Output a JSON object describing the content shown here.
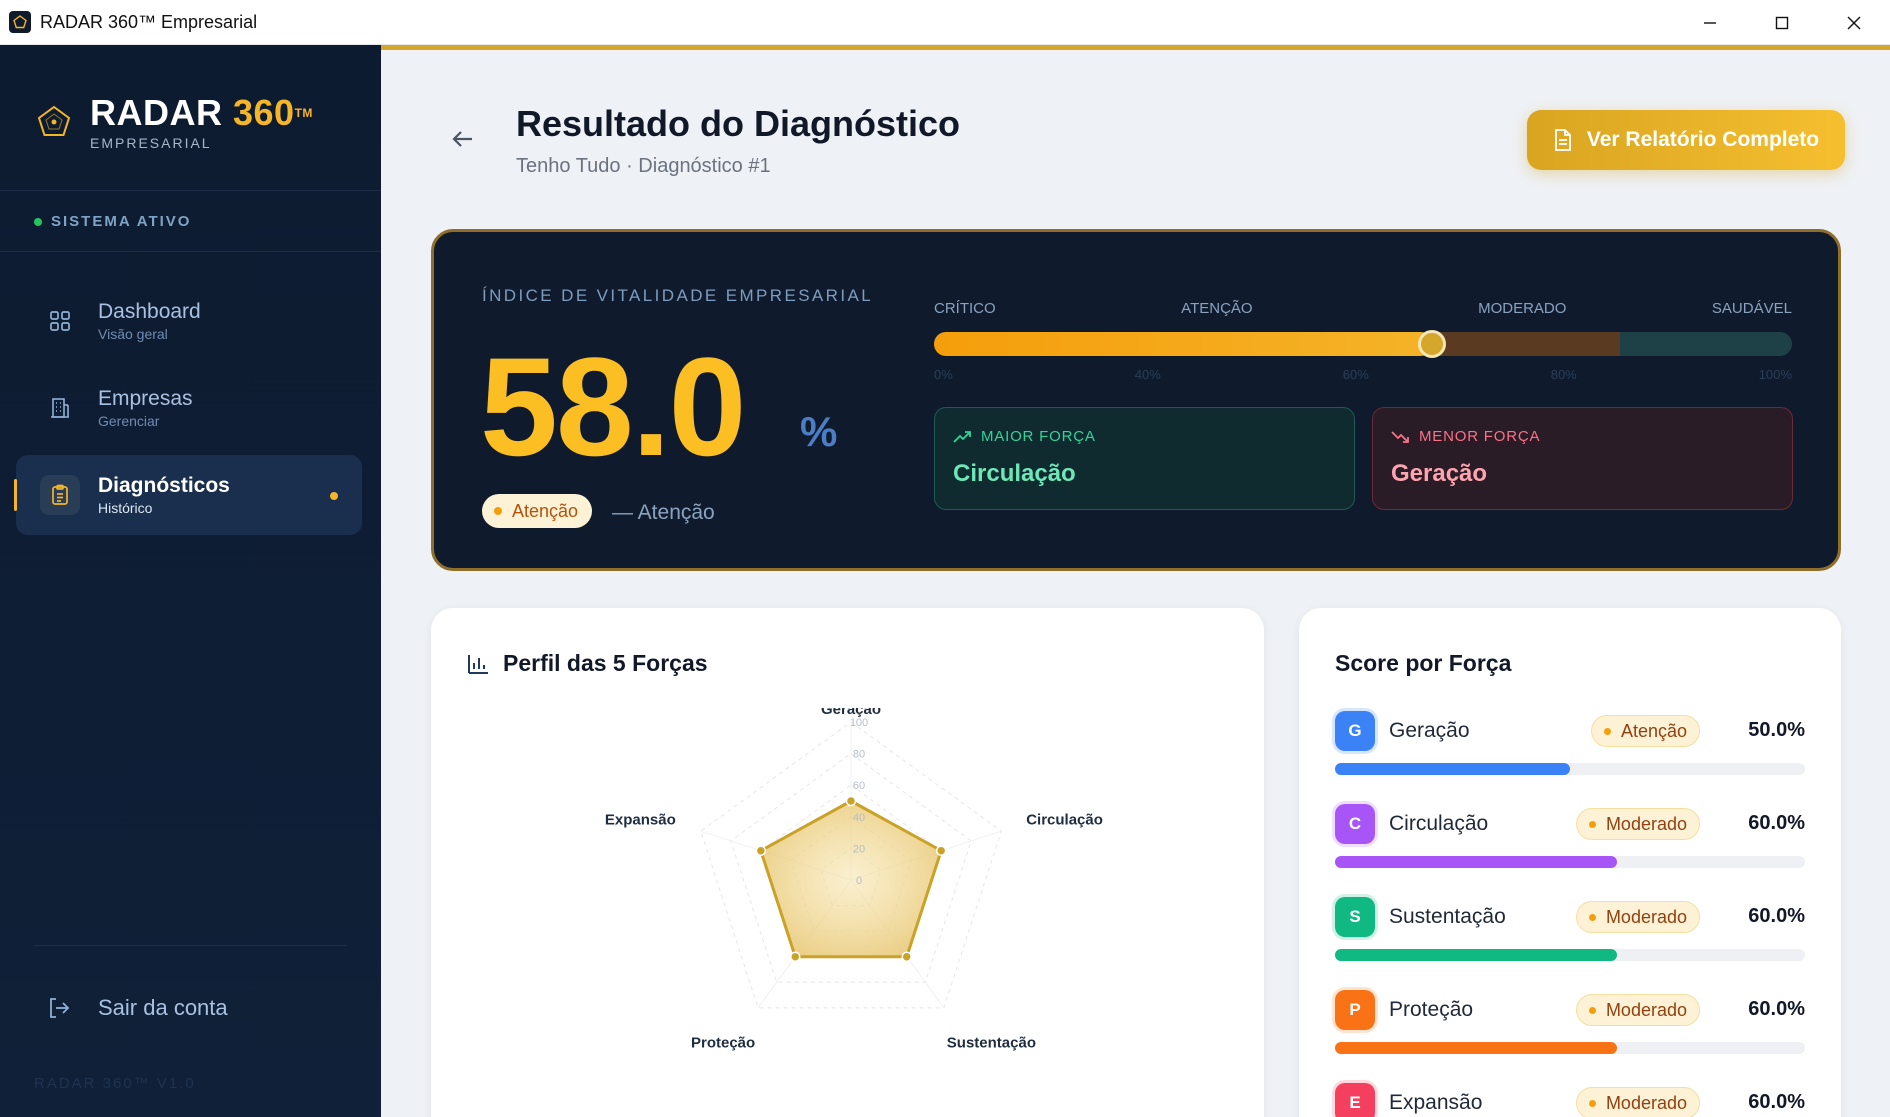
{
  "window": {
    "title": "RADAR 360™ Empresarial"
  },
  "sidebar": {
    "brand_main": "RADAR",
    "brand_num": "360",
    "brand_tm": "TM",
    "brand_sub": "EMPRESARIAL",
    "status": "SISTEMA ATIVO",
    "items": [
      {
        "label": "Dashboard",
        "sub": "Visão geral",
        "icon": "grid-icon"
      },
      {
        "label": "Empresas",
        "sub": "Gerenciar",
        "icon": "building-icon"
      },
      {
        "label": "Diagnósticos",
        "sub": "Histórico",
        "icon": "clipboard-icon"
      }
    ],
    "logout": "Sair da conta",
    "version": "RADAR 360™ V1.0"
  },
  "header": {
    "title": "Resultado do Diagnóstico",
    "subtitle": "Tenho Tudo · Diagnóstico #1",
    "report_button": "Ver Relatório Completo"
  },
  "hero": {
    "kicker": "ÍNDICE DE VITALIDADE EMPRESARIAL",
    "score": "58.0",
    "score_value": 58.0,
    "unit": "%",
    "status": "Atenção",
    "status_desc": "— Atenção",
    "scale_labels": [
      "CRÍTICO",
      "ATENÇÃO",
      "MODERADO",
      "SAUDÁVEL"
    ],
    "ticks": [
      "0%",
      "40%",
      "60%",
      "80%",
      "100%"
    ],
    "strongest_label": "MAIOR FORÇA",
    "strongest_value": "Circulação",
    "weakest_label": "MENOR FORÇA",
    "weakest_value": "Geração"
  },
  "radar_panel": {
    "title": "Perfil das 5 Forças",
    "axes": [
      "Geração",
      "Circulação",
      "Sustentação",
      "Proteção",
      "Expansão"
    ],
    "scale_ticks": [
      "100",
      "80",
      "60",
      "40",
      "20",
      "0"
    ]
  },
  "chart_data": {
    "type": "radar",
    "categories": [
      "Geração",
      "Circulação",
      "Sustentação",
      "Proteção",
      "Expansão"
    ],
    "values": [
      50,
      60,
      60,
      60,
      60
    ],
    "rlim": [
      0,
      100
    ],
    "ticks": [
      0,
      20,
      40,
      60,
      80,
      100
    ],
    "title": "Perfil das 5 Forças"
  },
  "scores_panel": {
    "title": "Score por Força",
    "rows": [
      {
        "letter": "G",
        "name": "Geração",
        "status": "Atenção",
        "pct": "50.0%",
        "value": 50.0,
        "color": "#3b82f6"
      },
      {
        "letter": "C",
        "name": "Circulação",
        "status": "Moderado",
        "pct": "60.0%",
        "value": 60.0,
        "color": "#a855f7"
      },
      {
        "letter": "S",
        "name": "Sustentação",
        "status": "Moderado",
        "pct": "60.0%",
        "value": 60.0,
        "color": "#10b981"
      },
      {
        "letter": "P",
        "name": "Proteção",
        "status": "Moderado",
        "pct": "60.0%",
        "value": 60.0,
        "color": "#f97316"
      },
      {
        "letter": "E",
        "name": "Expansão",
        "status": "Moderado",
        "pct": "60.0%",
        "value": 60.0,
        "color": "#f43f5e"
      }
    ]
  },
  "colors": {
    "accent": "#f4b528",
    "sidebar_bg": "#0f1b2d",
    "strong": "#34d399",
    "weak": "#fb7185"
  }
}
